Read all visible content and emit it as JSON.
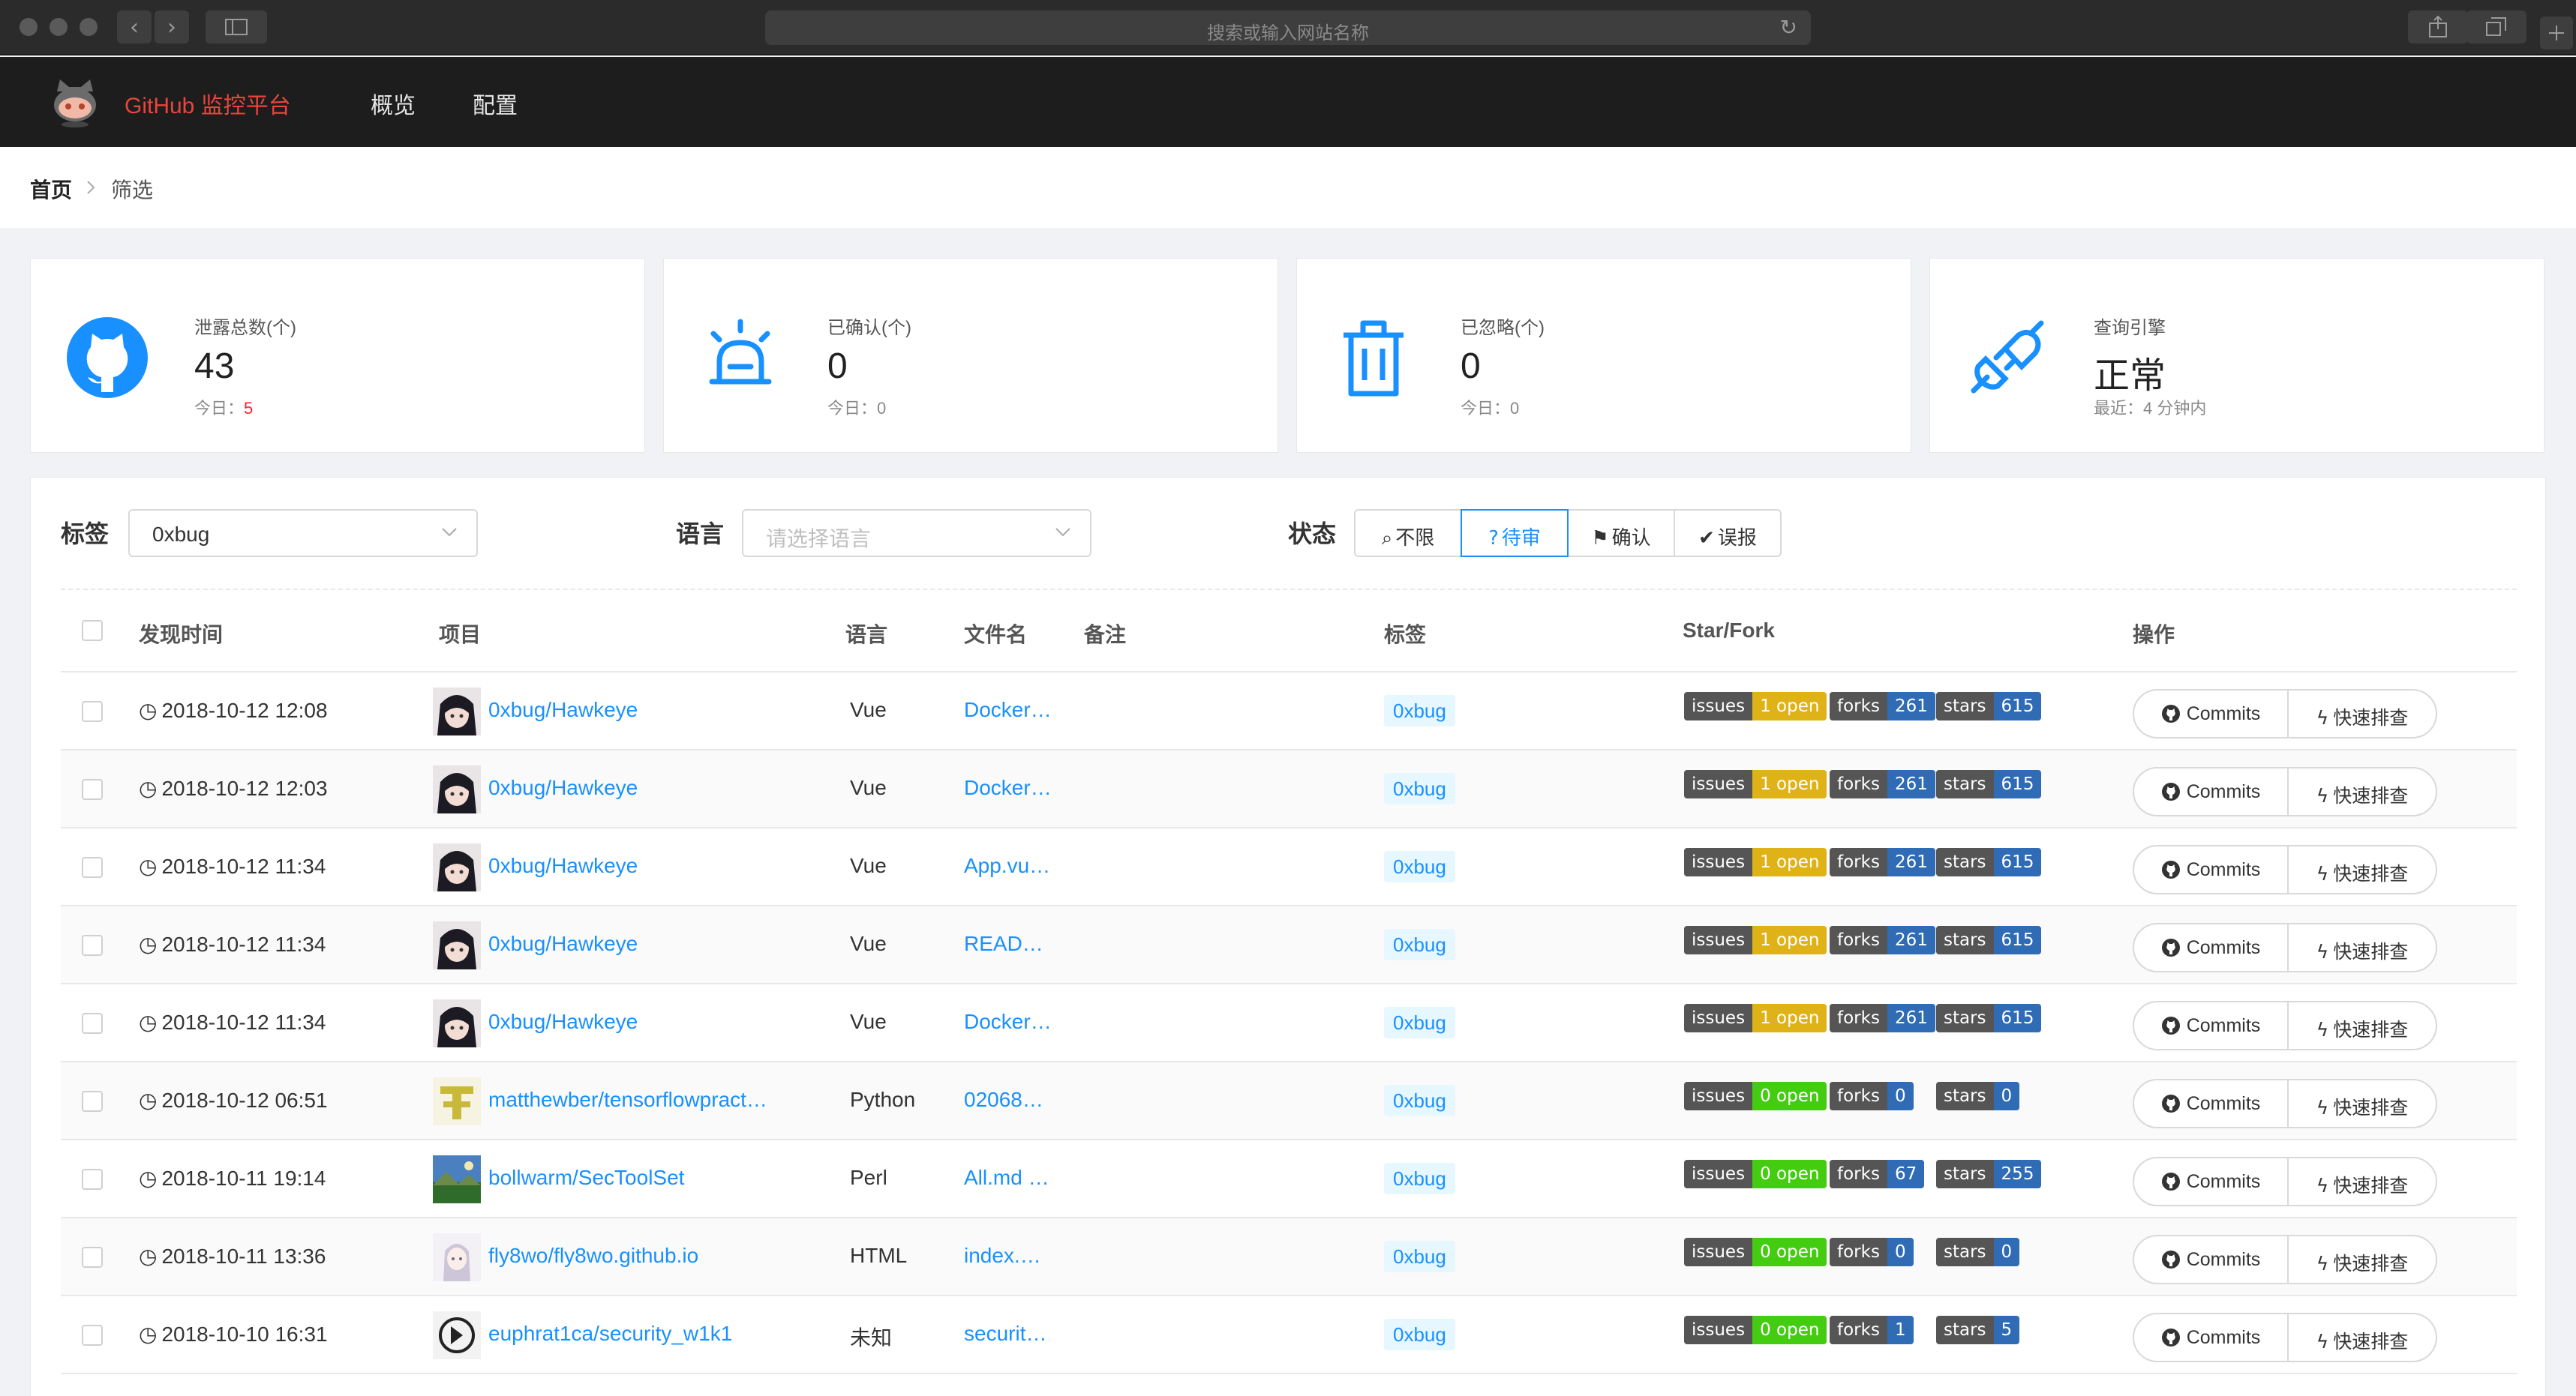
{
  "browser": {
    "address_placeholder": "搜索或输入网站名称",
    "back_glyph": "‹",
    "forward_glyph": "›",
    "reload_glyph": "↻"
  },
  "app": {
    "brand": "GitHub 监控平台",
    "nav": [
      "概览",
      "配置"
    ]
  },
  "breadcrumb": {
    "home": "首页",
    "current": "筛选"
  },
  "stats": [
    {
      "icon": "github-icon",
      "label": "泄露总数(个)",
      "value": "43",
      "sub_prefix": "今日：",
      "sub_value": "5",
      "sub_color": "#f5222d"
    },
    {
      "icon": "alarm-icon",
      "label": "已确认(个)",
      "value": "0",
      "sub_prefix": "今日：",
      "sub_value": "0",
      "sub_color": "#888888"
    },
    {
      "icon": "trash-icon",
      "label": "已忽略(个)",
      "value": "0",
      "sub_prefix": "今日：",
      "sub_value": "0",
      "sub_color": "#888888"
    },
    {
      "icon": "plug-icon",
      "label": "查询引擎",
      "value": "正常",
      "sub_prefix": "最近：",
      "sub_value": "4 分钟内",
      "sub_color": "#888888"
    }
  ],
  "filters": {
    "tag_label": "标签",
    "tag_value": "0xbug",
    "lang_label": "语言",
    "lang_placeholder": "请选择语言",
    "status_label": "状态",
    "status_options": [
      {
        "label": "不限",
        "glyph": "⌕",
        "active": false
      },
      {
        "label": "待审",
        "glyph": "?",
        "active": true
      },
      {
        "label": "确认",
        "glyph": "⚑",
        "active": false
      },
      {
        "label": "误报",
        "glyph": "✔",
        "active": false
      }
    ]
  },
  "table": {
    "columns": [
      "发现时间",
      "项目",
      "语言",
      "文件名",
      "备注",
      "标签",
      "Star/Fork",
      "操作"
    ],
    "commits_label": "Commits",
    "quick_label": "快速排查",
    "issues_label": "issues",
    "forks_label": "forks",
    "stars_label": "stars",
    "rows": [
      {
        "time": "2018-10-12 12:08",
        "project": "0xbug/Hawkeye",
        "avatar": "anime",
        "lang": "Vue",
        "file": "Docker…",
        "tag": "0xbug",
        "issues": "1 open",
        "issues_color": "#dfb317",
        "forks": "261",
        "stars": "615"
      },
      {
        "time": "2018-10-12 12:03",
        "project": "0xbug/Hawkeye",
        "avatar": "anime",
        "lang": "Vue",
        "file": "Docker…",
        "tag": "0xbug",
        "issues": "1 open",
        "issues_color": "#dfb317",
        "forks": "261",
        "stars": "615"
      },
      {
        "time": "2018-10-12 11:34",
        "project": "0xbug/Hawkeye",
        "avatar": "anime",
        "lang": "Vue",
        "file": "App.vu…",
        "tag": "0xbug",
        "issues": "1 open",
        "issues_color": "#dfb317",
        "forks": "261",
        "stars": "615"
      },
      {
        "time": "2018-10-12 11:34",
        "project": "0xbug/Hawkeye",
        "avatar": "anime",
        "lang": "Vue",
        "file": "READ…",
        "tag": "0xbug",
        "issues": "1 open",
        "issues_color": "#dfb317",
        "forks": "261",
        "stars": "615"
      },
      {
        "time": "2018-10-12 11:34",
        "project": "0xbug/Hawkeye",
        "avatar": "anime",
        "lang": "Vue",
        "file": "Docker…",
        "tag": "0xbug",
        "issues": "1 open",
        "issues_color": "#dfb317",
        "forks": "261",
        "stars": "615"
      },
      {
        "time": "2018-10-12 06:51",
        "project": "matthewber/tensorflowpract…",
        "avatar": "tf",
        "lang": "Python",
        "file": "02068…",
        "tag": "0xbug",
        "issues": "0 open",
        "issues_color": "#4c1",
        "forks": "0",
        "stars": "0"
      },
      {
        "time": "2018-10-11 19:14",
        "project": "bollwarm/SecToolSet",
        "avatar": "landscape",
        "lang": "Perl",
        "file": "All.md …",
        "tag": "0xbug",
        "issues": "0 open",
        "issues_color": "#4c1",
        "forks": "67",
        "stars": "255"
      },
      {
        "time": "2018-10-11 13:36",
        "project": "fly8wo/fly8wo.github.io",
        "avatar": "girl",
        "lang": "HTML",
        "file": "index.…",
        "tag": "0xbug",
        "issues": "0 open",
        "issues_color": "#4c1",
        "forks": "0",
        "stars": "0"
      },
      {
        "time": "2018-10-10 16:31",
        "project": "euphrat1ca/security_w1k1",
        "avatar": "dark",
        "lang": "未知",
        "file": "securit…",
        "tag": "0xbug",
        "issues": "0 open",
        "issues_color": "#4c1",
        "forks": "1",
        "stars": "5"
      }
    ]
  },
  "colors": {
    "accent": "#1890ff",
    "brand_red": "#e8453c",
    "badge_blue": "#2f6cb5"
  }
}
